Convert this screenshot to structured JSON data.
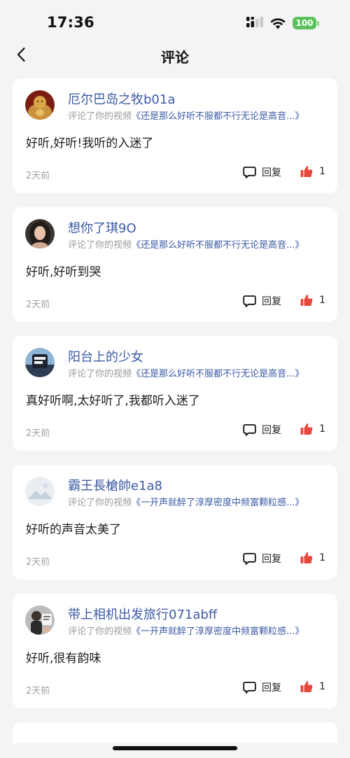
{
  "status_bar": {
    "time": "17:36",
    "battery": "100"
  },
  "nav": {
    "title": "评论",
    "back_icon": "chevron-left-icon"
  },
  "comments": [
    {
      "username": "厄尔巴岛之牧b01a",
      "action_text": "评论了你的视频",
      "video_title": "《还是那么好听不服都不行无论是高音...》",
      "content": "好听,好听!我听的入迷了",
      "time": "2天前",
      "reply_label": "回复",
      "likes": "1",
      "avatar": "buddha-statue"
    },
    {
      "username": "想你了琪9O",
      "action_text": "评论了你的视频",
      "video_title": "《还是那么好听不服都不行无论是高音...》",
      "content": "好听,好听到哭",
      "time": "2天前",
      "reply_label": "回复",
      "likes": "1",
      "avatar": "woman-portrait"
    },
    {
      "username": "阳台上的少女",
      "action_text": "评论了你的视频",
      "video_title": "《还是那么好听不服都不行无论是高音...》",
      "content": "真好听啊,太好听了,我都听入迷了",
      "time": "2天前",
      "reply_label": "回复",
      "likes": "1",
      "avatar": "sticker-photo"
    },
    {
      "username": "霸王長槍帥e1a8",
      "action_text": "评论了你的视频",
      "video_title": "《一开声就醉了淳厚密度中频富颗粒感...》",
      "content": "好听的声音太美了",
      "time": "2天前",
      "reply_label": "回复",
      "likes": "1",
      "avatar": "default-avatar"
    },
    {
      "username": "带上相机出发旅行071abff",
      "action_text": "评论了你的视频",
      "video_title": "《一开声就醉了淳厚密度中频富颗粒感...》",
      "content": "好听,很有韵味",
      "time": "2天前",
      "reply_label": "回复",
      "likes": "1",
      "avatar": "man-portrait"
    }
  ],
  "colors": {
    "background": "#f4f4f6",
    "username": "#3b5aa5",
    "like": "#e8473b",
    "battery": "#5bc25a"
  }
}
